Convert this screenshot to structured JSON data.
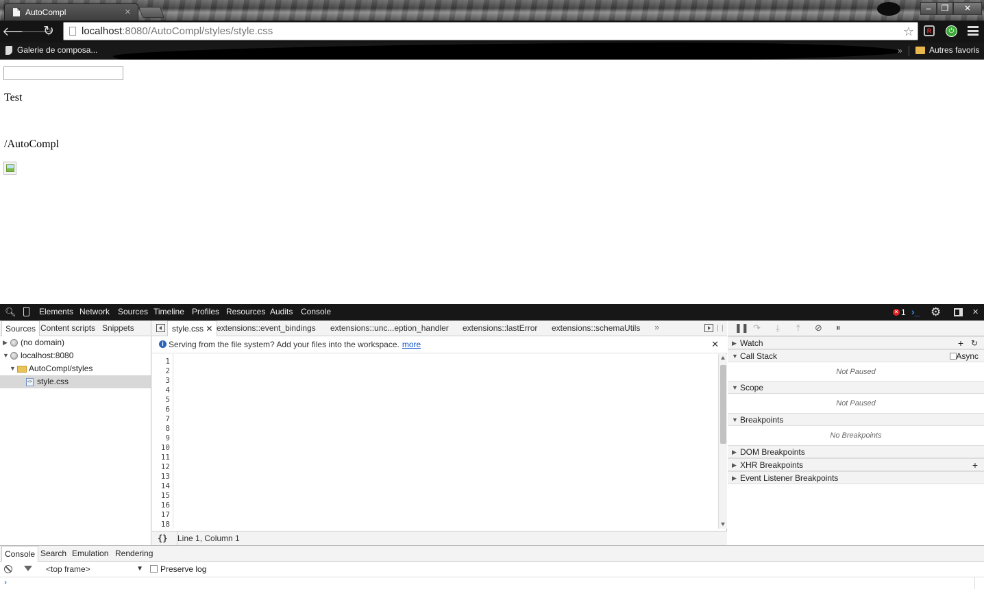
{
  "browser": {
    "tab_title": "AutoCompl",
    "url_host": "localhost",
    "url_path": ":8080/AutoCompl/styles/style.css",
    "bookmark_galerie": "Galerie de composa...",
    "bookmark_other": "Autres favoris",
    "bookmark_overflow": "»",
    "ext1_label": "R"
  },
  "page": {
    "text_test": "Test",
    "text_path": "/AutoCompl"
  },
  "devtools": {
    "tabs": [
      "Elements",
      "Network",
      "Sources",
      "Timeline",
      "Profiles",
      "Resources",
      "Audits",
      "Console"
    ],
    "error_count": "1",
    "navigator": {
      "tabs": [
        "Sources",
        "Content scripts",
        "Snippets"
      ],
      "tree": [
        "(no domain)",
        "localhost:8080",
        "AutoCompl/styles",
        "style.css"
      ]
    },
    "editor": {
      "open_tabs": [
        "style.css",
        "extensions::event_bindings",
        "extensions::unc...eption_handler",
        "extensions::lastError",
        "extensions::schemaUtils"
      ],
      "tabs_overflow": "»",
      "info_text": "Serving from the file system? Add your files into the workspace.",
      "info_link": "more",
      "line_numbers": [
        "1",
        "2",
        "3",
        "4",
        "5",
        "6",
        "7",
        "8",
        "9",
        "10",
        "11",
        "12",
        "13",
        "14",
        "15",
        "16",
        "17",
        "18"
      ],
      "pretty_print": "{}",
      "cursor_position": "Line 1, Column 1"
    },
    "sidebar": {
      "sections": {
        "watch": "Watch",
        "call_stack": "Call Stack",
        "async": "Async",
        "scope": "Scope",
        "breakpoints": "Breakpoints",
        "dom_breakpoints": "DOM Breakpoints",
        "xhr_breakpoints": "XHR Breakpoints",
        "event_listener_breakpoints": "Event Listener Breakpoints"
      },
      "not_paused": "Not Paused",
      "no_breakpoints": "No Breakpoints"
    },
    "drawer": {
      "tabs": [
        "Console",
        "Search",
        "Emulation",
        "Rendering"
      ],
      "frame": "<top frame>",
      "preserve_log": "Preserve log"
    }
  }
}
